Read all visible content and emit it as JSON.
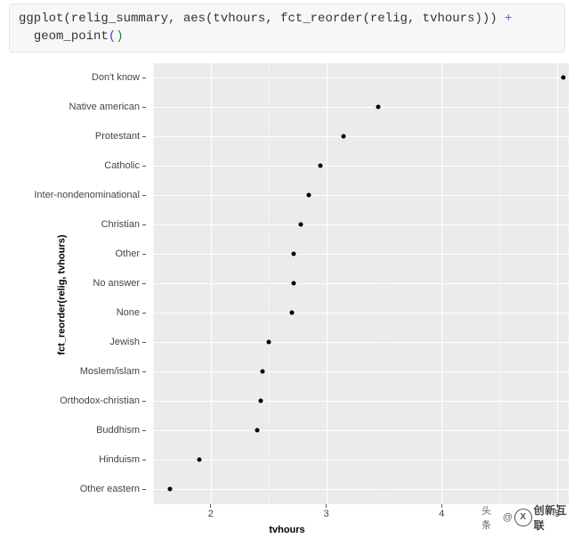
{
  "code": {
    "line1_pre": "ggplot(relig_summary, aes(tvhours, fct_reorder(relig, tvhours))) ",
    "line1_op": "+",
    "line2_indent": "  ",
    "line2_fn": "geom_point",
    "line2_po": "(",
    "line2_pc": ")"
  },
  "chart_data": {
    "type": "scatter",
    "title": "",
    "xlabel": "tvhours",
    "ylabel": "fct_reorder(relig, tvhours)",
    "xlim": [
      1.5,
      5.1
    ],
    "x_ticks": [
      2,
      3,
      4,
      5
    ],
    "x_minor": [
      1.5,
      2.5,
      3.5,
      4.5
    ],
    "categories": [
      "Don't know",
      "Native american",
      "Protestant",
      "Catholic",
      "Inter-nondenominational",
      "Christian",
      "Other",
      "No answer",
      "None",
      "Jewish",
      "Moslem/islam",
      "Orthodox-christian",
      "Buddhism",
      "Hinduism",
      "Other eastern"
    ],
    "values": [
      5.05,
      3.45,
      3.15,
      2.95,
      2.85,
      2.78,
      2.72,
      2.72,
      2.7,
      2.5,
      2.45,
      2.43,
      2.4,
      1.9,
      1.65
    ]
  },
  "watermark": {
    "left": "头条",
    "sep": "@",
    "brand": "创新互联"
  }
}
